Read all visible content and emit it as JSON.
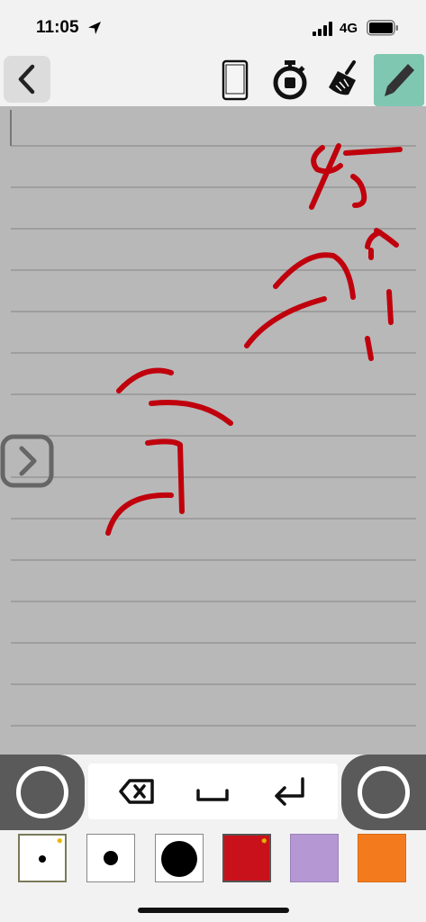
{
  "status_bar": {
    "time": "11:05",
    "network": "4G"
  },
  "toolbar": {
    "back": "back-icon",
    "icons": [
      "phone-frame-icon",
      "stopwatch-icon",
      "broom-icon",
      "pencil-icon"
    ],
    "active_color": "#7fc7b1"
  },
  "canvas": {
    "background": "#b8b8b8",
    "line_color": "#8f8f8f",
    "ink_color": "#c0000c",
    "next_button": "chevron-right-icon"
  },
  "keypad": {
    "keys": [
      "backspace-icon",
      "space-icon",
      "return-icon"
    ]
  },
  "palette": {
    "swatches": [
      {
        "name": "small-dot-pen",
        "fill": "#ffffff",
        "selected": true
      },
      {
        "name": "medium-dot-pen",
        "fill": "#ffffff",
        "selected": false
      },
      {
        "name": "large-dot-pen",
        "fill": "#ffffff",
        "selected": false
      },
      {
        "name": "red-color",
        "fill": "#c8111a",
        "selected": true
      },
      {
        "name": "lavender-color",
        "fill": "#b597d4",
        "selected": false
      },
      {
        "name": "orange-color",
        "fill": "#f37b1e",
        "selected": false
      }
    ]
  }
}
